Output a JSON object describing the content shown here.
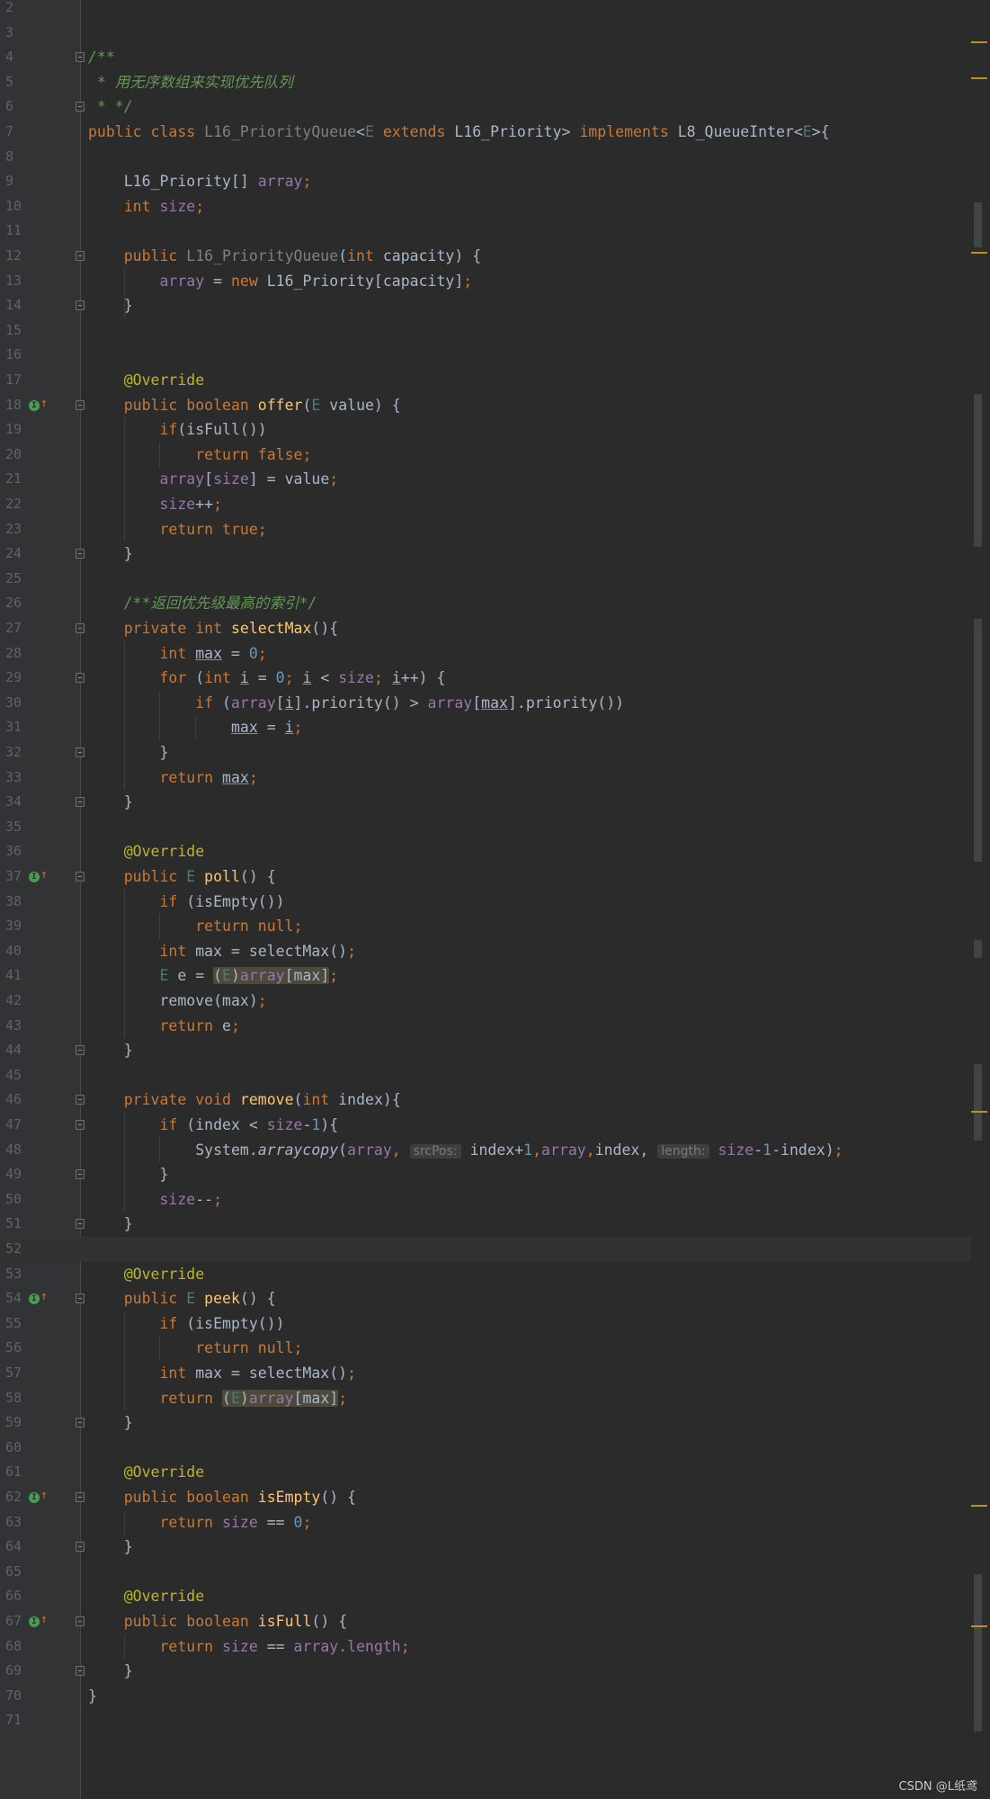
{
  "editor": {
    "line_numbers": [
      "2",
      "3",
      "4",
      "5",
      "6",
      "7",
      "8",
      "9",
      "10",
      "11",
      "12",
      "13",
      "14",
      "15",
      "16",
      "17",
      "18",
      "19",
      "20",
      "21",
      "22",
      "23",
      "24",
      "25",
      "26",
      "27",
      "28",
      "29",
      "30",
      "31",
      "32",
      "33",
      "34",
      "35",
      "36",
      "37",
      "38",
      "39",
      "40",
      "41",
      "42",
      "43",
      "44",
      "45",
      "46",
      "47",
      "48",
      "49",
      "50",
      "51",
      "52",
      "53",
      "54",
      "55",
      "56",
      "57",
      "58",
      "59",
      "60",
      "61",
      "62",
      "63",
      "64",
      "65",
      "66",
      "67",
      "68",
      "69",
      "70",
      "71"
    ],
    "current_line": "52",
    "tokens": {
      "javadoc_open": "/**",
      "javadoc_line": " * 用无序数组来实现优先队列",
      "javadoc_close": " * */",
      "public": "public",
      "class": "class",
      "class_name": "L16_PriorityQueue",
      "lt": "<",
      "gt": ">",
      "type_param": "E",
      "extends": "extends",
      "bound_type": "L16_Priority",
      "implements": "implements",
      "interface": "L8_QueueInter",
      "class_close": ">{",
      "array_type": "L16_Priority[]",
      "array_field": "array",
      "int": "int",
      "size_field": "size",
      "semicolon": ";",
      "ctor_params_open": "(",
      "capacity_param": "capacity",
      "ctor_params_close": ") {",
      "assign": " = ",
      "new": "new",
      "new_expr": "L16_Priority[capacity]",
      "rbrace": "}",
      "override": "@Override",
      "boolean": "boolean",
      "offer": "offer",
      "value_param": " value) {",
      "if": "if",
      "is_full_call": "(isFull())",
      "return": "return",
      "false": "false",
      "lbracket": "[",
      "rbracket": "]",
      "value": "value",
      "incr": "++",
      "true": "true",
      "select_comment": "/**返回优先级最高的索引*/",
      "private": "private",
      "select_max": "selectMax",
      "empty_parens_brace": "(){",
      "max_var": "max",
      "zero": "0",
      "for": "for",
      "for_open": " (",
      "i_var": "i",
      "lt_op": " < ",
      "inc_brace": "++) {",
      "if_open": " (",
      "priority_cmp": "].priority() > ",
      "priority_close": "].priority())",
      "max_assign": " = ",
      "poll": "poll",
      "parens_brace": "() {",
      "is_empty_call": " (isEmpty())",
      "null": "null",
      "max_call": " max = selectMax()",
      "e_var": " e = ",
      "cast_open": "(",
      "cast_close": ")",
      "max_index": "max",
      "remove_max": "remove(max)",
      "return_e": " e",
      "void": "void",
      "remove": "remove",
      "index_param": " index){",
      "index_lt": " (index < ",
      "minus_one": "-",
      "one": "1",
      "brace_open": "){",
      "system_prefix": "System.",
      "arraycopy": "arraycopy",
      "comma": ",",
      "src_pos_hint": "srcPos:",
      "index_plus": "index+",
      "index_comma": "index,",
      "length_hint": "length:",
      "index_close": "index)",
      "decr": "--",
      "peek": "peek",
      "is_empty": "isEmpty",
      "eq_zero": " == ",
      "is_full": "isFull",
      "eq": " == ",
      "dot_length": ".length",
      "brace_close": "}"
    }
  },
  "gutter": {
    "implements_icon": "implements-method-icon",
    "implements_icon_glyph": "I",
    "implements_arrow": "↑"
  },
  "watermark": "CSDN @L纸鸢",
  "colors": {
    "background": "#2b2b2b",
    "keyword": "#cc7832",
    "field": "#9876aa",
    "method": "#ffc66d",
    "number": "#6897bb",
    "annotation": "#bbb529",
    "comment": "#629755"
  }
}
